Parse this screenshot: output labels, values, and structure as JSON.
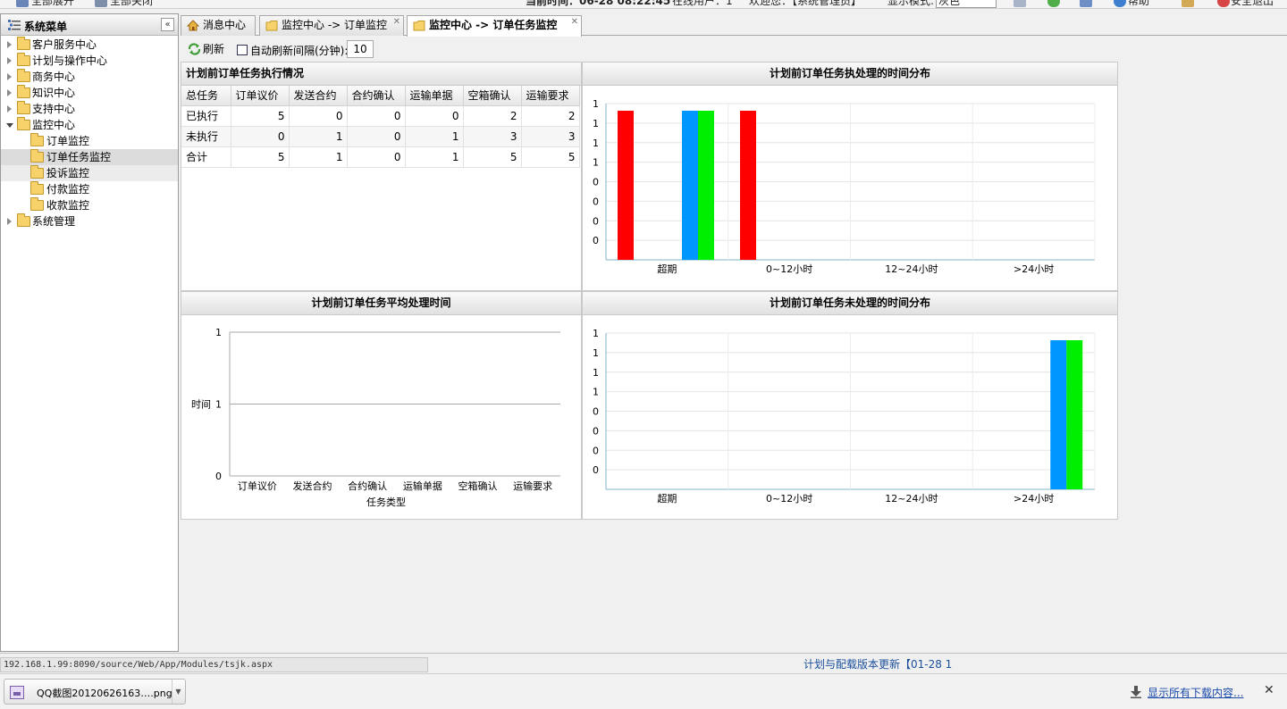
{
  "topbar": {
    "expand_all": "全部展开",
    "collapse_all": "全部关闭",
    "time_label": "当前时间：06-28 08:22:45",
    "online_users": "在线用户：1",
    "welcome": "欢迎您：【系统管理员】",
    "display_mode_label": "显示模式:",
    "display_mode_value": "灰色",
    "help": "帮助",
    "logout": "安全退出"
  },
  "sidebar": {
    "title": "系统菜单",
    "collapse": "«",
    "items": [
      {
        "label": "客户服务中心"
      },
      {
        "label": "计划与操作中心"
      },
      {
        "label": "商务中心"
      },
      {
        "label": "知识中心"
      },
      {
        "label": "支持中心"
      },
      {
        "label": "监控中心"
      },
      {
        "label": "订单监控"
      },
      {
        "label": "订单任务监控"
      },
      {
        "label": "投诉监控"
      },
      {
        "label": "付款监控"
      },
      {
        "label": "收款监控"
      },
      {
        "label": "系统管理"
      }
    ]
  },
  "tabs": [
    {
      "label": "消息中心"
    },
    {
      "label": "监控中心 -> 订单监控"
    },
    {
      "label": "监控中心 -> 订单任务监控"
    }
  ],
  "toolbar": {
    "refresh": "刷新",
    "auto_refresh": "自动刷新间隔(分钟):",
    "interval": "10"
  },
  "table_panel": {
    "title": "计划前订单任务执行情况",
    "headers": [
      "总任务",
      "订单议价",
      "发送合约",
      "合约确认",
      "运输单据",
      "空箱确认",
      "运输要求"
    ],
    "rows": [
      [
        "已执行",
        "5",
        "0",
        "0",
        "0",
        "2",
        "2"
      ],
      [
        "未执行",
        "0",
        "1",
        "0",
        "1",
        "3",
        "3"
      ],
      [
        "合计",
        "5",
        "1",
        "0",
        "1",
        "5",
        "5"
      ]
    ]
  },
  "chart_data": [
    {
      "type": "bar",
      "title": "计划前订单任务执处理的时间分布",
      "categories": [
        "超期",
        "0~12小时",
        "12~24小时",
        ">24小时"
      ],
      "ytick_labels": [
        "1",
        "1",
        "1",
        "1",
        "0",
        "0",
        "0",
        "0"
      ],
      "ylim": [
        0,
        1
      ],
      "grid": true,
      "series": [
        {
          "color": "#ff0000",
          "values": [
            1,
            0,
            0,
            0
          ]
        },
        {
          "color": "#0096ff",
          "values": [
            0,
            0,
            0,
            0
          ]
        },
        {
          "color": "#00ee00",
          "values": [
            0,
            0,
            0,
            0
          ]
        },
        {
          "color": "#ff0000",
          "values": [
            0,
            0,
            0,
            0
          ]
        }
      ],
      "note_series_layout": "超期 group shows red, blue, green, red bars each reaching the top"
    },
    {
      "type": "bar",
      "title": "计划前订单任务平均处理时间",
      "categories": [
        "订单议价",
        "发送合约",
        "合约确认",
        "运输单据",
        "空箱确认",
        "运输要求"
      ],
      "ytick_labels": [
        "1",
        "1",
        "0"
      ],
      "ylabel": "时间",
      "xlabel": "任务类型",
      "ylim": [
        0,
        1
      ],
      "grid": true,
      "series": [
        {
          "values": [
            0,
            0,
            0,
            0,
            0,
            0
          ]
        }
      ]
    },
    {
      "type": "bar",
      "title": "计划前订单任务未处理的时间分布",
      "categories": [
        "超期",
        "0~12小时",
        "12~24小时",
        ">24小时"
      ],
      "ytick_labels": [
        "1",
        "1",
        "1",
        "1",
        "0",
        "0",
        "0",
        "0"
      ],
      "ylim": [
        0,
        1
      ],
      "grid": true,
      "series": [
        {
          "color": "#0096ff",
          "values": [
            0,
            0,
            0,
            1
          ]
        },
        {
          "color": "#00ee00",
          "values": [
            0,
            0,
            0,
            1
          ]
        }
      ]
    }
  ],
  "status": {
    "url": "192.168.1.99:8090/source/Web/App/Modules/tsjk.aspx",
    "marquee": "计划与配载版本更新【01-28 1"
  },
  "downloads": {
    "file": "QQ截图20120626163….png",
    "show_all": "显示所有下载内容...",
    "close": "✕"
  }
}
